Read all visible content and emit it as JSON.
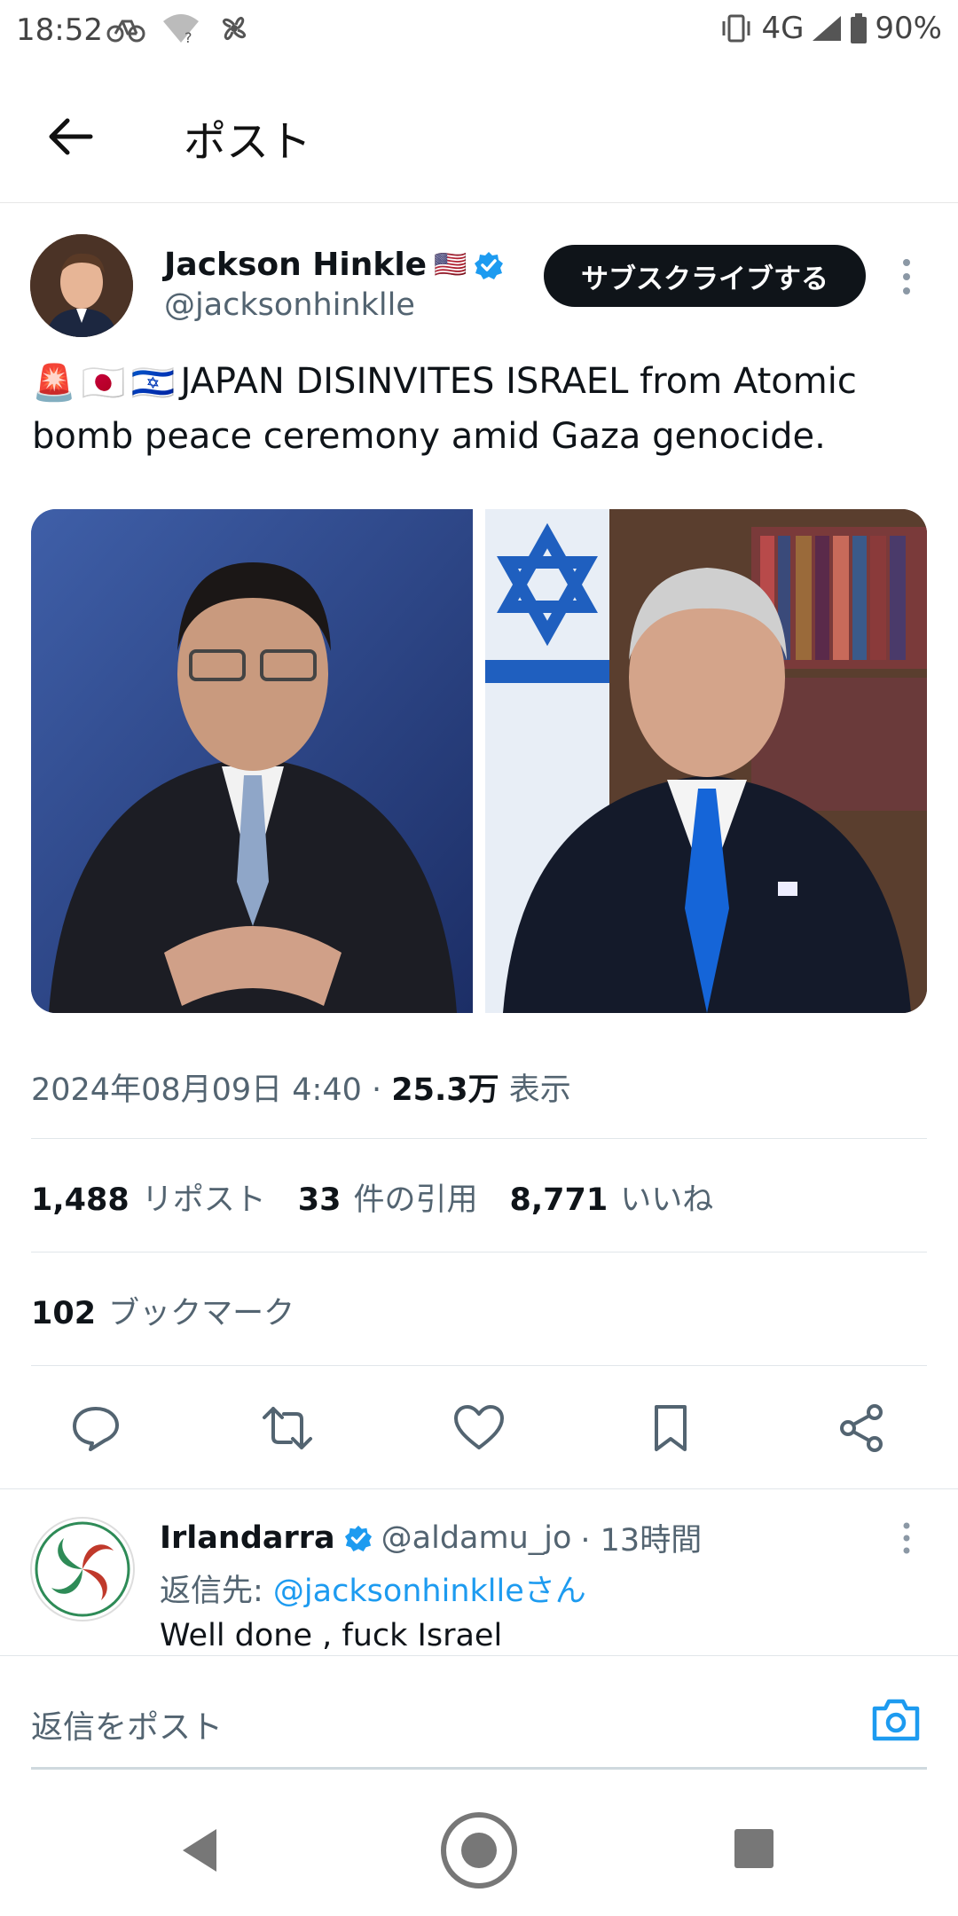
{
  "status_bar": {
    "time": "18:52",
    "network": "4G",
    "battery": "90%"
  },
  "header": {
    "title": "ポスト"
  },
  "author": {
    "name": "Jackson Hinkle",
    "handle": "@jacksonhinklle",
    "flag": "🇺🇸"
  },
  "subscribe_label": "サブスクライブする",
  "tweet": {
    "emojis": [
      "🚨",
      "🇯🇵",
      "🇮🇱"
    ],
    "text": "JAPAN DISINVITES ISRAEL from Atomic bomb peace ceremony amid Gaza genocide."
  },
  "meta": {
    "datetime": "2024年08月09日 4:40",
    "views_count": "25.3万",
    "views_label": "表示"
  },
  "stats": {
    "reposts_count": "1,488",
    "reposts_label": "リポスト",
    "quotes_count": "33",
    "quotes_label": "件の引用",
    "likes_count": "8,771",
    "likes_label": "いいね",
    "bookmarks_count": "102",
    "bookmarks_label": "ブックマーク"
  },
  "actions": [
    "reply-icon",
    "repost-icon",
    "like-icon",
    "bookmark-icon",
    "share-icon"
  ],
  "reply": {
    "name": "Irlandarra",
    "handle": "@aldamu_jo",
    "time": "· 13時間",
    "reply_to_prefix": "返信先: ",
    "reply_to_link": "@jacksonhinklleさん",
    "text": "Well done , fuck Israel"
  },
  "compose": {
    "placeholder": "返信をポスト"
  },
  "colors": {
    "accent": "#1d9bf0",
    "dark": "#0f1419",
    "muted": "#536471"
  }
}
